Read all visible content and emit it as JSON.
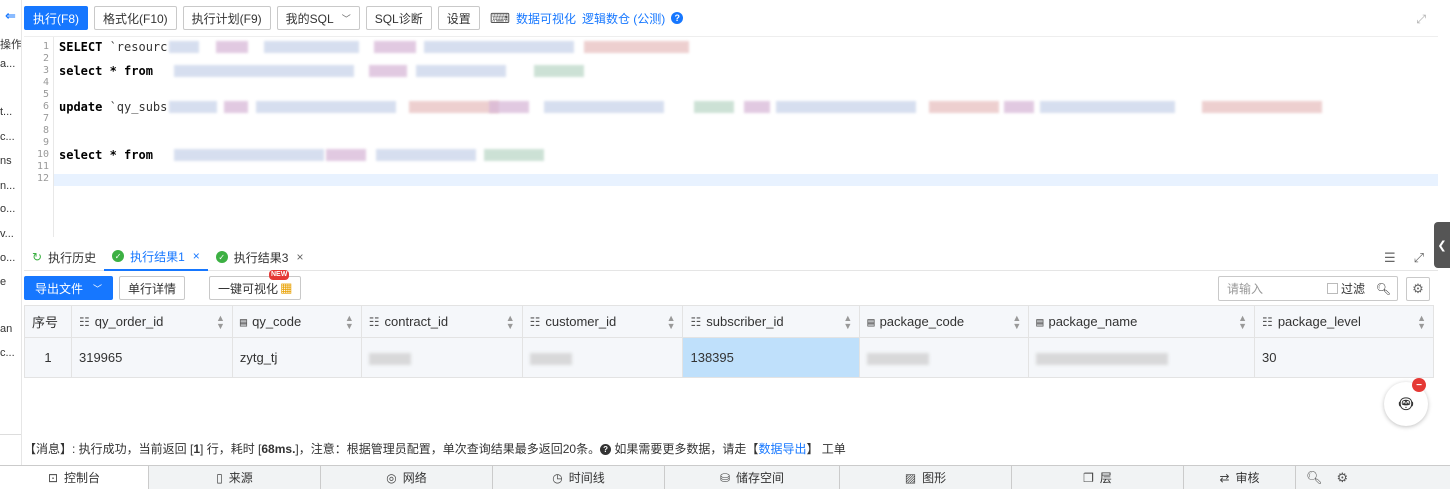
{
  "left_strip": {
    "fragments": [
      "操作.",
      "a...",
      "t...",
      "c...",
      "ns",
      "n...",
      "o...",
      "v...",
      "o...",
      "e",
      "an",
      "c..."
    ]
  },
  "toolbar": {
    "execute": "执行(F8)",
    "format": "格式化(F10)",
    "plan": "执行计划(F9)",
    "my_sql": "我的SQL",
    "sql_diag": "SQL诊断",
    "settings": "设置",
    "data_viz": "数据可视化",
    "logic_dw": "逻辑数仓 (公测)"
  },
  "editor": {
    "line_numbers": [
      "1",
      "2",
      "3",
      "4",
      "5",
      "6",
      "7",
      "8",
      "9",
      "10",
      "11",
      "12"
    ],
    "lines": [
      {
        "n": 1,
        "kw": "SELECT",
        "rest": " `resourc"
      },
      {
        "n": 3,
        "kw": "select * from",
        "rest": ""
      },
      {
        "n": 6,
        "kw": "update",
        "rest": " `qy_subs"
      },
      {
        "n": 10,
        "kw": "select * from",
        "rest": ""
      }
    ]
  },
  "result_tabs": {
    "history": "执行历史",
    "result1": "执行结果1",
    "result3": "执行结果3"
  },
  "result_toolbar": {
    "export": "导出文件",
    "row_detail": "单行详情",
    "one_click_viz": "一键可视化",
    "new_badge": "NEW",
    "filter_placeholder": "请输入",
    "filter_label": "过滤"
  },
  "table": {
    "columns": [
      "序号",
      "qy_order_id",
      "qy_code",
      "contract_id",
      "customer_id",
      "subscriber_id",
      "package_code",
      "package_name",
      "package_level"
    ],
    "rows": [
      [
        "1",
        "319965",
        "zytg_tj",
        "",
        "",
        "138395",
        "",
        "",
        "30"
      ]
    ]
  },
  "status": {
    "prefix": "【消息】: 执行成功，当前返回 [",
    "rows": "1",
    "mid": "] 行，耗时 [",
    "time": "68ms.",
    "suffix": "]，注意：根据管理员配置，单次查询结果最多返回20条。",
    "more": " 如果需要更多数据，请走【",
    "export_link": "数据导出",
    "tail": "】 工单"
  },
  "devtools": {
    "tabs": [
      "控制台",
      "来源",
      "网络",
      "时间线",
      "储存空间",
      "图形",
      "层",
      "审核"
    ]
  },
  "colors": {
    "primary": "#1677ff",
    "success": "#3cb043",
    "selected_cell": "#bfe0fb"
  }
}
